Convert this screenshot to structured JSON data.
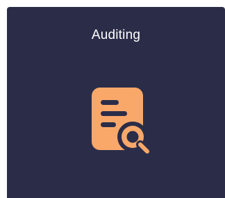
{
  "tile": {
    "title": "Auditing",
    "icon": "document-search-icon",
    "colors": {
      "background": "#2b2d48",
      "title": "#ffffff",
      "icon_fill": "#f9a86a",
      "icon_stroke": "#2b2d48"
    }
  }
}
